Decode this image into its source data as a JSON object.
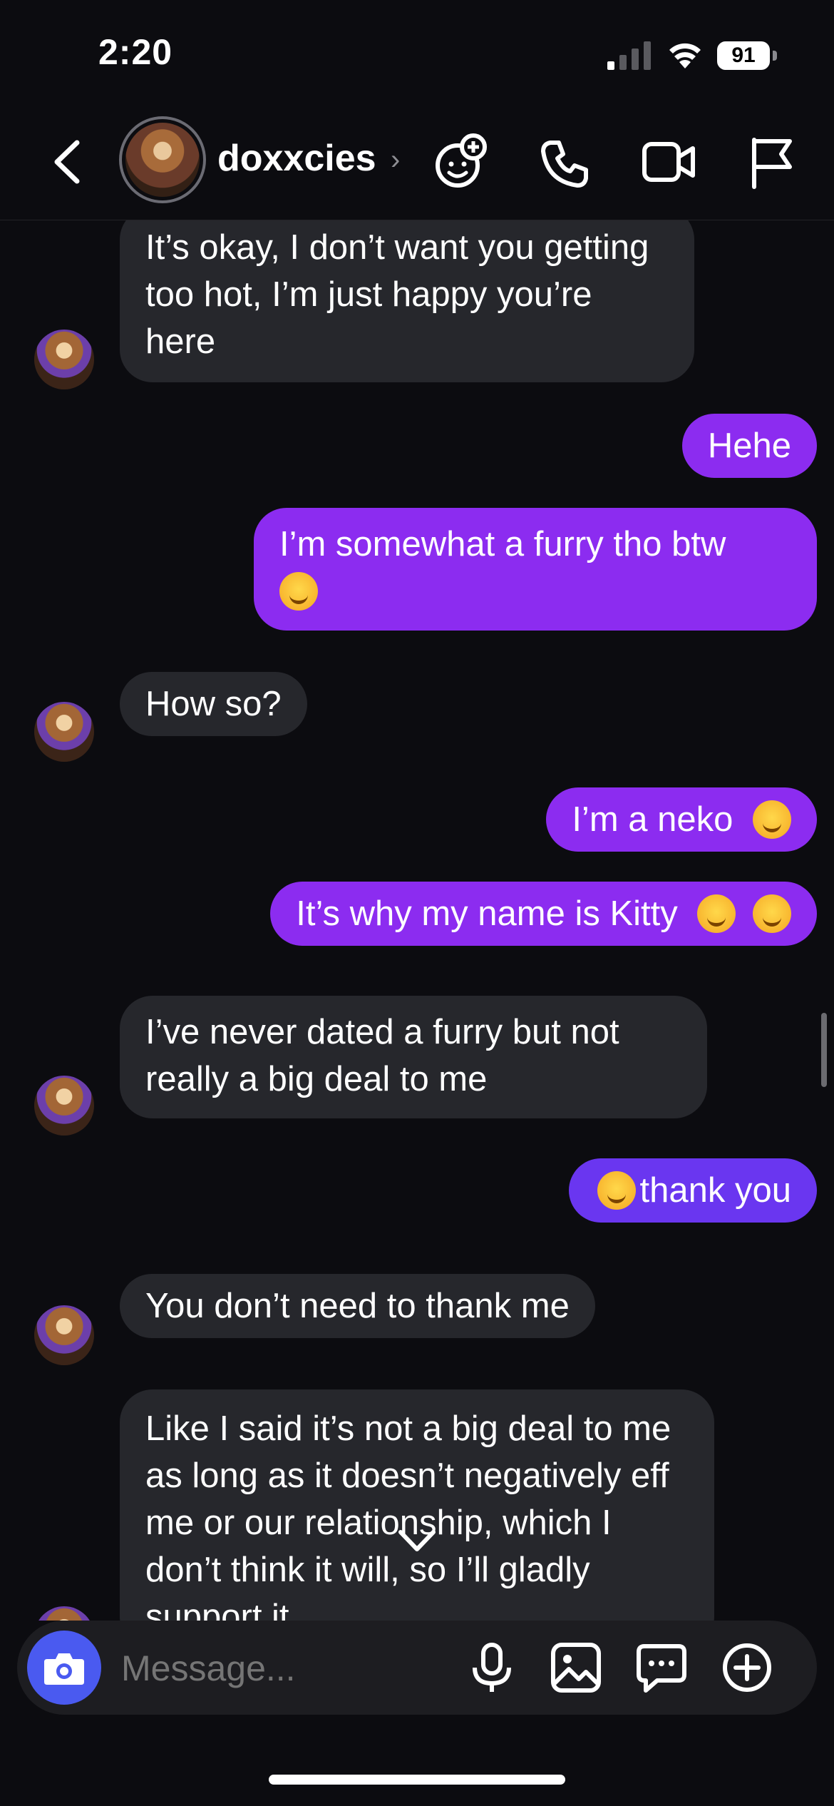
{
  "status": {
    "time": "2:20",
    "battery": "91"
  },
  "header": {
    "username": "doxxcies",
    "chevron": "›"
  },
  "icons": {
    "back": "back-chevron-icon",
    "effects": "sticker-add-icon",
    "call": "phone-icon",
    "video": "video-camera-icon",
    "report": "flag-icon",
    "camera": "camera-icon",
    "mic": "microphone-icon",
    "gallery": "image-icon",
    "sticker": "chat-bubble-icon",
    "plus": "plus-circle-icon"
  },
  "messages": [
    {
      "side": "in",
      "text": "It’s okay, I don’t want you getting too hot, I’m just happy you’re here"
    },
    {
      "side": "out",
      "text": "Hehe"
    },
    {
      "side": "out",
      "text": "I’m somewhat a furry tho btw"
    },
    {
      "side": "in",
      "text": "How so?"
    },
    {
      "side": "out",
      "text": "I’m a neko"
    },
    {
      "side": "out",
      "text": "It’s why my name is Kitty"
    },
    {
      "side": "in",
      "text": "I’ve never dated a furry but not really a big deal to me"
    },
    {
      "side": "out",
      "text": "thank you"
    },
    {
      "side": "in",
      "text": "You don’t need to thank me"
    },
    {
      "side": "in",
      "text": "Like I said it’s not a big deal to me as long as it doesn’t negatively eff me or our relationship, which I don’t think it will, so I’ll gladly support it"
    }
  ],
  "composer": {
    "placeholder": "Message..."
  }
}
